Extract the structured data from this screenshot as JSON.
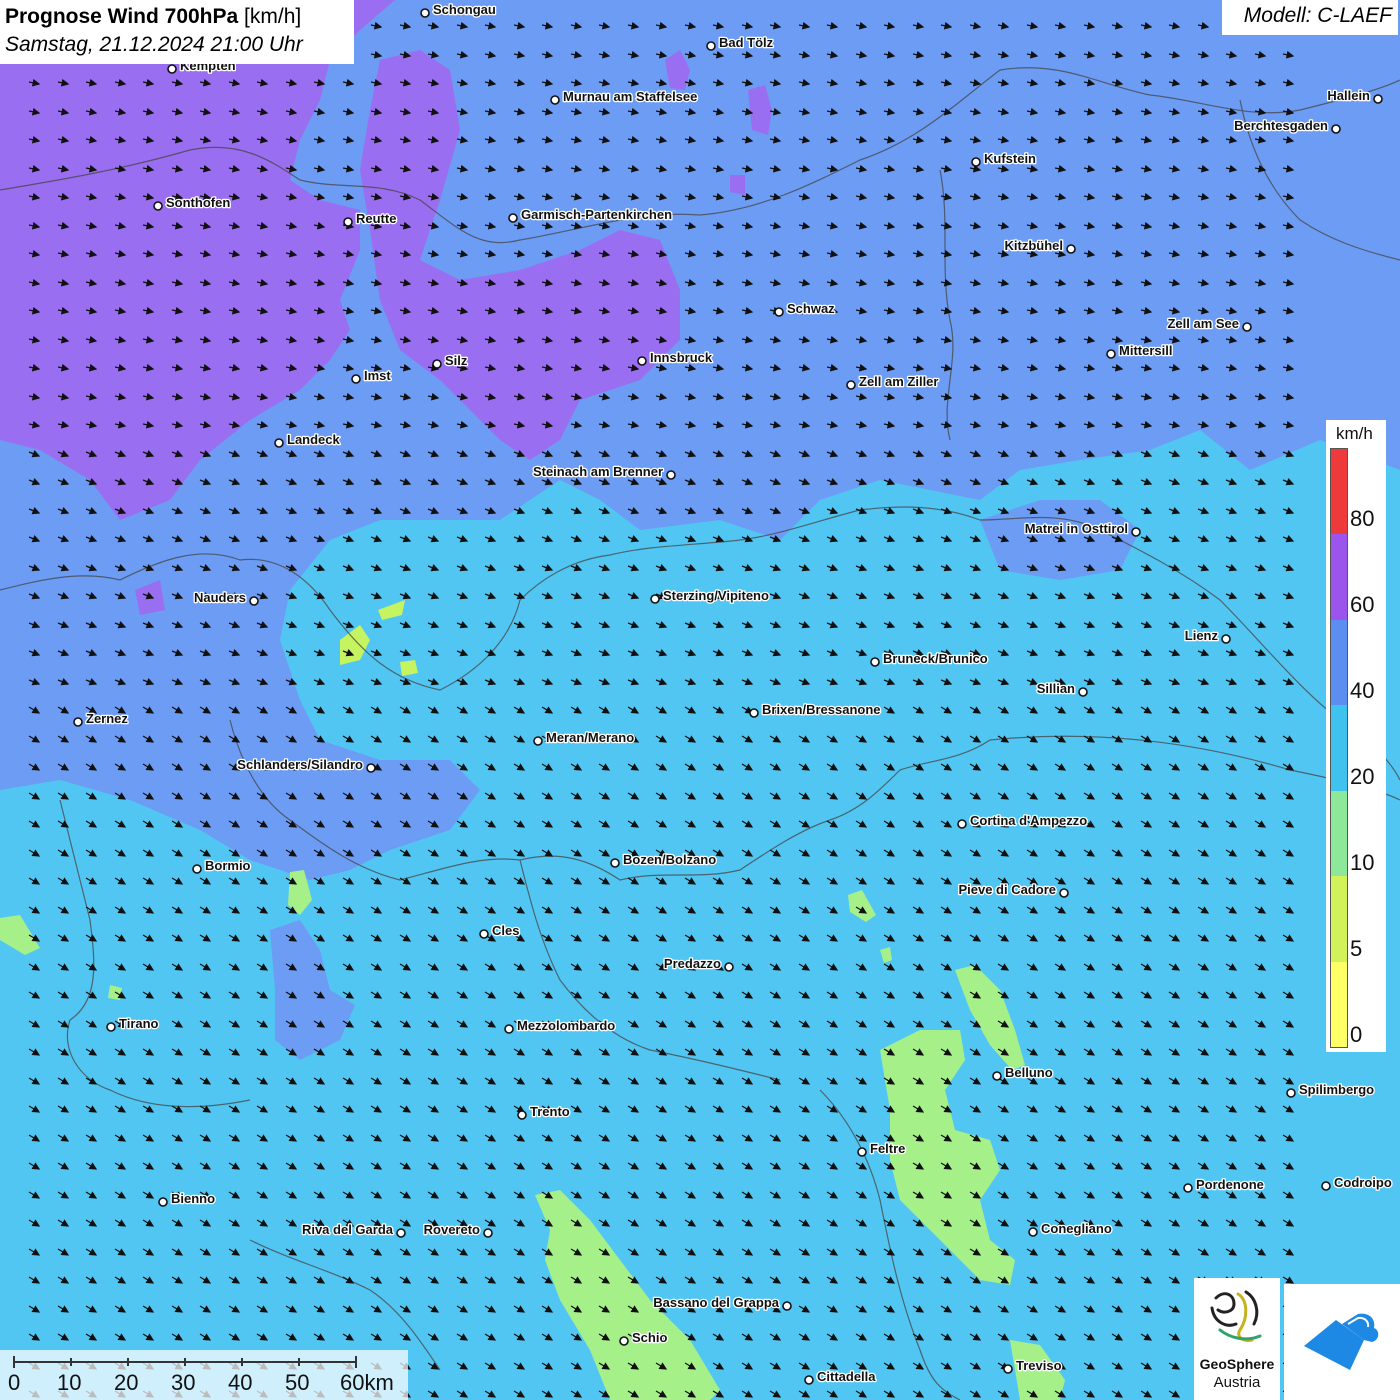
{
  "header": {
    "title_bold": "Prognose Wind 700hPa",
    "title_unit": "[km/h]",
    "datetime": "Samstag, 21.12.2024 21:00 Uhr",
    "model": "Modell: C-LAEF"
  },
  "legend": {
    "unit": "km/h",
    "ticks": [
      "80",
      "60",
      "40",
      "20",
      "10",
      "5",
      "0"
    ],
    "colors": [
      "#ee3a3a",
      "#9b55ec",
      "#5b8ef0",
      "#3fc3ee",
      "#8ee89a",
      "#d2f25c",
      "#ffff66"
    ]
  },
  "scalebar": {
    "labels": [
      "0",
      "10",
      "20",
      "30",
      "40",
      "50",
      "60km"
    ]
  },
  "logos": {
    "geosphere_name": "GeoSphere",
    "geosphere_sub": "Austria",
    "geosphere_icon": "geosphere-logo-icon",
    "warn_icon": "warn-app-logo-icon"
  },
  "colors": {
    "cyan_field": "#52c6f2",
    "blue_field": "#6c9cf4",
    "violet_field": "#9a6ef0",
    "green_field": "#a6f08a",
    "lime_field": "#c6f460"
  },
  "wind": {
    "direction": "from north-west",
    "arrow_icon": "wind-arrow-icon"
  },
  "cities": [
    "Schongau",
    "Bad Tölz",
    "Kempten",
    "Murnau am Staffelsee",
    "Hallein",
    "Berchtesgaden",
    "Kufstein",
    "Sonthofen",
    "Reutte",
    "Garmisch-Partenkirchen",
    "Kitzbühel",
    "Schwaz",
    "Zell am See",
    "Mittersill",
    "Innsbruck",
    "Silz",
    "Imst",
    "Zell am Ziller",
    "Landeck",
    "Steinach am Brenner",
    "Matrei in Osttirol",
    "Nauders",
    "Sterzing/Vipiteno",
    "Lienz",
    "Bruneck/Brunico",
    "Sillian",
    "Zernez",
    "Brixen/Bressanone",
    "Meran/Merano",
    "Schlanders/Silandro",
    "Cortina d'Ampezzo",
    "Bozen/Bolzano",
    "Bormio",
    "Pieve di Cadore",
    "Cles",
    "Predazzo",
    "Tirano",
    "Mezzolombardo",
    "Belluno",
    "Spilimbergo",
    "Trento",
    "Feltre",
    "Pordenone",
    "Codroipo",
    "Bienno",
    "Riva del Garda",
    "Rovereto",
    "Conegliano",
    "Bassano del Grappa",
    "Schio",
    "Treviso",
    "Cittadella"
  ]
}
